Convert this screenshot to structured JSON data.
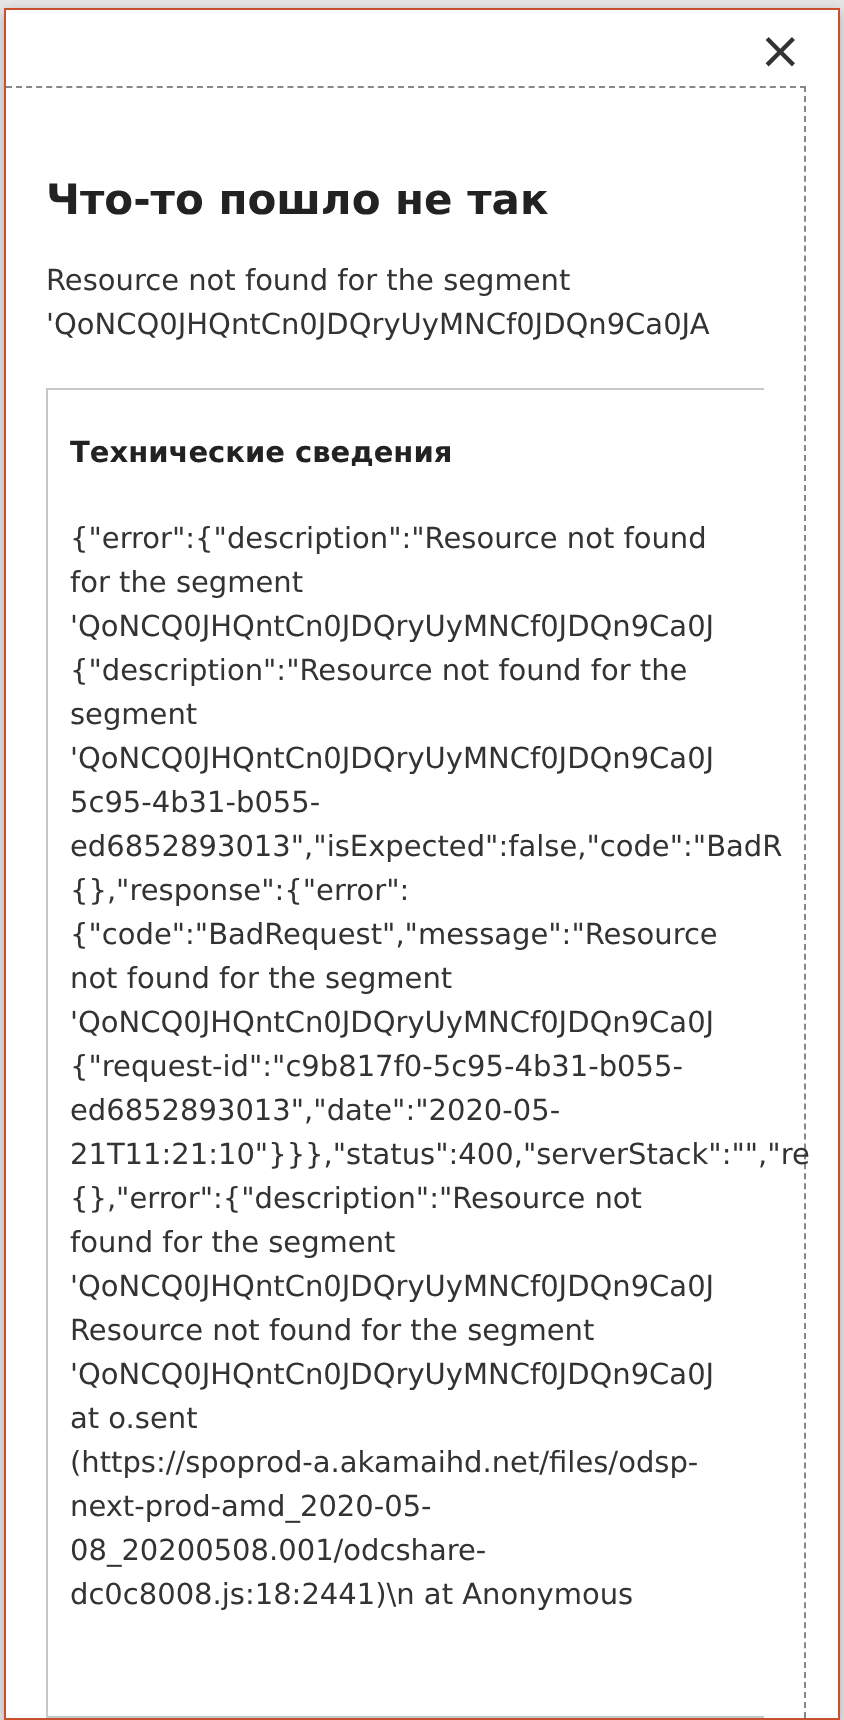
{
  "dialog": {
    "close": "×",
    "title": "Что-то пошло не так",
    "message": [
      "Resource not found for the segment",
      "'QoNCQ0JHQntCn0JDQryUyMNCf0JDQn9Ca0JA"
    ],
    "details": {
      "title": "Технические сведения",
      "lines": [
        "{\"error\":{\"description\":\"Resource not found",
        "for the segment",
        "'QoNCQ0JHQntCn0JDQryUyMNCf0JDQn9Ca0J",
        "{\"description\":\"Resource not found for the",
        "segment",
        "'QoNCQ0JHQntCn0JDQryUyMNCf0JDQn9Ca0J",
        "5c95-4b31-b055-",
        "ed6852893013\",\"isExpected\":false,\"code\":\"BadR",
        "{},\"response\":{\"error\":",
        "{\"code\":\"BadRequest\",\"message\":\"Resource",
        "not found for the segment",
        "'QoNCQ0JHQntCn0JDQryUyMNCf0JDQn9Ca0J",
        "{\"request-id\":\"c9b817f0-5c95-4b31-b055-",
        "ed6852893013\",\"date\":\"2020-05-",
        "21T11:21:10\"}}},\"status\":400,\"serverStack\":\"\",\"re",
        "{},\"error\":{\"description\":\"Resource not",
        "found for the segment",
        "'QoNCQ0JHQntCn0JDQryUyMNCf0JDQn9Ca0J",
        "Resource not found for the segment",
        "'QoNCQ0JHQntCn0JDQryUyMNCf0JDQn9Ca0J",
        "at o.sent",
        "(https://spoprod-a.akamaihd.net/files/odsp-",
        "next-prod-amd_2020-05-",
        "08_20200508.001/odcshare-",
        "dc0c8008.js:18:2441)\\n at Anonymous"
      ]
    }
  }
}
